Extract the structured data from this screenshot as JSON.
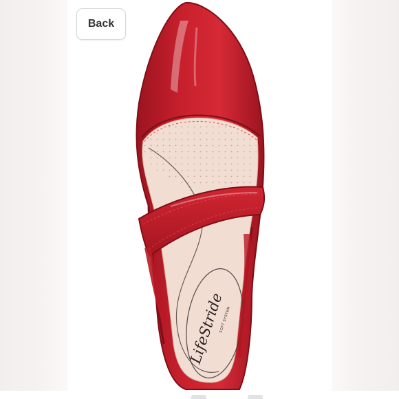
{
  "toolbar": {
    "back_label": "Back"
  },
  "product_image": {
    "insole_brand": "LifeStride",
    "insole_subbrand": "SOFT SYSTEM",
    "colors": {
      "patent_red": "#c7202c",
      "patent_dark": "#8e1119",
      "insole": "#f1ddd2"
    }
  }
}
